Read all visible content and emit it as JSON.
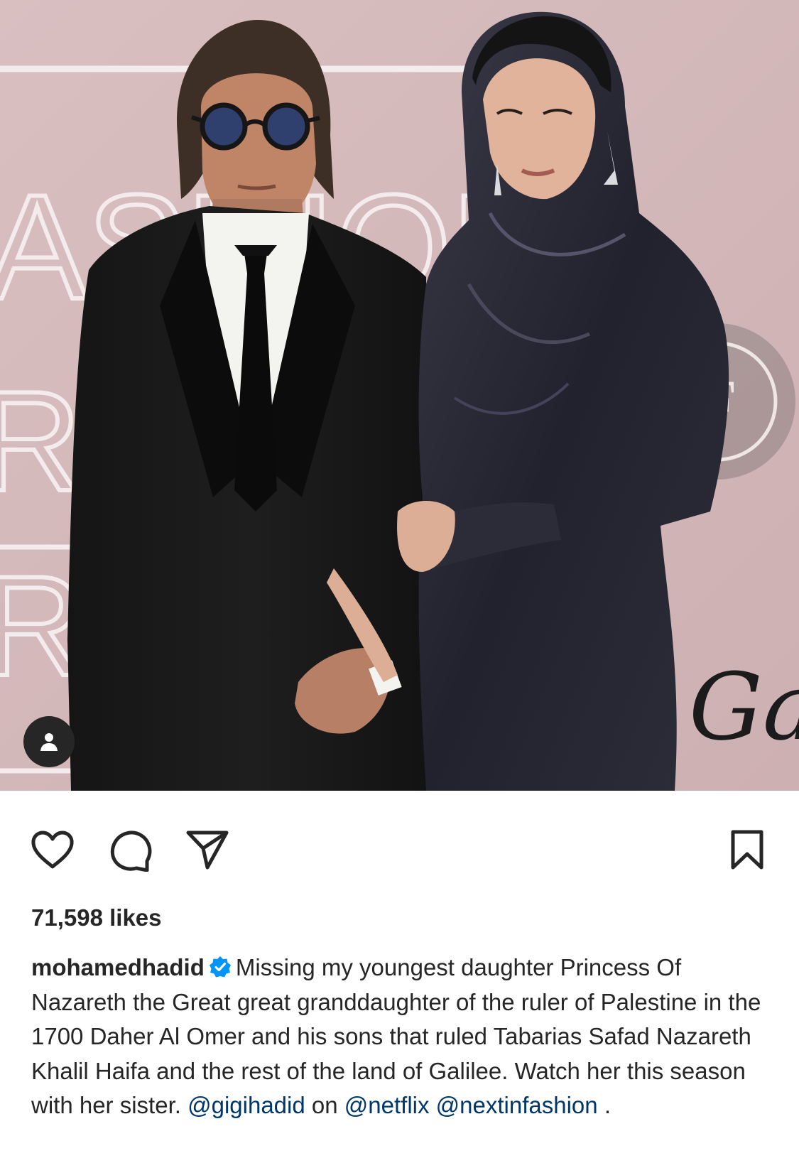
{
  "post": {
    "likes": "71,598 likes",
    "username": "mohamedhadid",
    "caption_text": "Missing my youngest daughter Princess Of Nazareth the Great great granddaughter of the ruler of Palestine in the 1700 Daher Al Omer and his sons that ruled Tabarias Safad Nazareth Khalil Haifa and the rest of the land of Galilee. Watch her this season with her sister.",
    "mentions": [
      "@gigihadid",
      "@netflix",
      "@nextinfashion"
    ],
    "connector": "on",
    "trailing": "."
  },
  "backdrop_text": {
    "line1": "ASHION",
    "line2": "RU",
    "line3": "R",
    "logo_letter": "F",
    "script": "Gal"
  },
  "icons": {
    "tag": "person-icon",
    "like": "heart-icon",
    "comment": "comment-bubble-icon",
    "share": "paper-plane-icon",
    "save": "bookmark-icon",
    "verified": "verified-badge-icon"
  },
  "colors": {
    "backdrop": "#d4b7b8",
    "text": "#262626",
    "mention": "#00376b",
    "verified": "#0095f6"
  }
}
